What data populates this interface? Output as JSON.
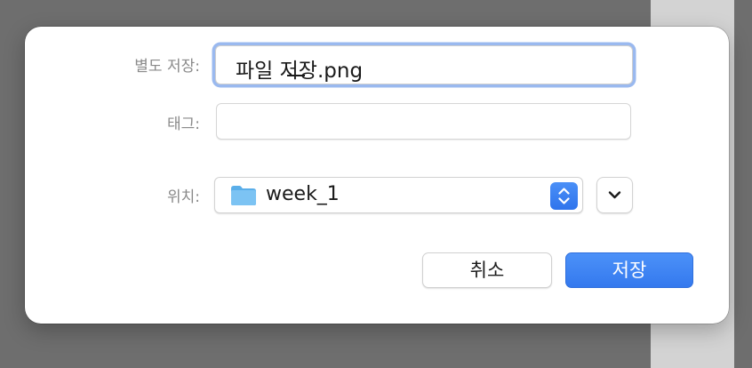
{
  "dialog": {
    "save_as_label": "별도 저장:",
    "save_as_value": "파일 저장.png",
    "tags_label": "태그:",
    "tags_value": "",
    "location_label": "위치:",
    "location_value": "week_1",
    "location_icon": "folder-icon",
    "stepper_icon": "up-down-chevron-icon",
    "expand_icon": "chevron-down-icon",
    "cancel_label": "취소",
    "save_label": "저장"
  },
  "colors": {
    "accent": "#3b82f6",
    "focus_ring": "#9ab9ef",
    "label": "#8a8a8a"
  }
}
